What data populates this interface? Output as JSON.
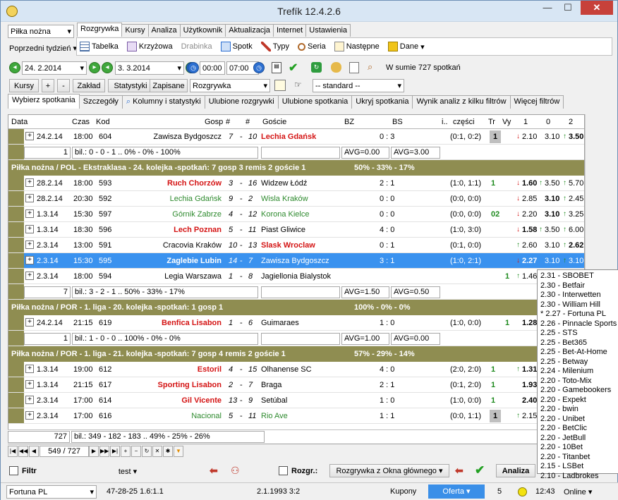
{
  "window": {
    "title": "Trefík 12.4.2.6",
    "min": "—",
    "max": "☐",
    "close": "✕"
  },
  "sport_select": "Piłka nożna",
  "period_select": "Poprzedni tydzień",
  "main_tabs": [
    "Rozgrywka",
    "Kursy",
    "Analiza",
    "Użytkownik",
    "Aktualizacja",
    "Internet",
    "Ustawienia"
  ],
  "ribbon": {
    "tabelka": "Tabelka",
    "krzyzowa": "Krzyżowa",
    "drabinka": "Drabinka",
    "spotk": "Spotk",
    "typy": "Typy",
    "seria": "Seria",
    "nastepne": "Następne",
    "dane": "Dane"
  },
  "filter_row": {
    "date_from": "24. 2.2014",
    "date_to": "3. 3.2014",
    "time_from": "00:00",
    "time_to": "07:00",
    "total": "W sumie 727 spotkań"
  },
  "buttons_row": {
    "kursy": "Kursy",
    "plus": "+",
    "minus": "-",
    "zaklad": "Zakład",
    "statystyki": "Statystyki",
    "zapisane": "Zapisane",
    "rozgrywka_select": "Rozgrywka",
    "standard_select": "-- standard --"
  },
  "sub_tabs": [
    "Wybierz spotkania",
    "Szczegóły",
    "Kolumny i statystyki",
    "Ulubione rozgrywki",
    "Ulubione spotkania",
    "Ukryj spotkania",
    "Wynik analiz z kilku filtrów",
    "Więcej filtrów"
  ],
  "columns": {
    "data": "Data",
    "czas": "Czas",
    "kod": "Kod",
    "gosp": "Gosp",
    "h": "#",
    "a": "#",
    "goscie": "Goście",
    "bz": "BZ",
    "bs": "BS",
    "i": "i..",
    "czesci": "części",
    "tr": "Tr",
    "vy": "Vy",
    "o1": "1",
    "o0": "0",
    "o2": "2"
  },
  "groups": [
    {
      "title": "",
      "matches": [
        {
          "date": "24.2.14",
          "time": "18:00",
          "code": "604",
          "home": "Zawisza Bydgoszcz",
          "hs": "red0",
          "hr": "7",
          "ar": "10",
          "away": "Lechia Gdańsk",
          "as": "red",
          "bz": "0 : 3",
          "bs": "",
          "parts": "(0:1, 0:2)",
          "tr": "1",
          "trbox": true,
          "vy": "",
          "o1": "2.10",
          "o0": "3.10",
          "o2": "3.50",
          "a1": "dn",
          "a0": "",
          "a2": "up",
          "b": "2"
        }
      ],
      "summary": {
        "count": "1",
        "bil": "bil.: 0 - 0 - 1 .. 0% - 0% - 100%",
        "avg1": "AVG=0.00",
        "avg2": "AVG=3.00"
      }
    },
    {
      "title": "Piłka nożna / POL - Ekstraklasa - 24. kolejka -spotkań: 7 gosp 3  remis 2  goście 1",
      "stats": "50% - 33% - 17%",
      "matches": [
        {
          "date": "28.2.14",
          "time": "18:00",
          "code": "593",
          "home": "Ruch Chorzów",
          "hs": "red",
          "hr": "3",
          "ar": "16",
          "away": "Widzew Łódź",
          "as": "",
          "bz": "2 : 1",
          "parts": "(1:0, 1:1)",
          "tr": "1",
          "trcls": "grnb",
          "vy": "",
          "o1": "1.60",
          "o0": "3.50",
          "o2": "5.70",
          "a1": "dn",
          "a0": "up",
          "a2": "up",
          "b": "1"
        },
        {
          "date": "28.2.14",
          "time": "20:30",
          "code": "592",
          "home": "Lechia Gdańsk",
          "hs": "grn",
          "hr": "9",
          "ar": "2",
          "away": "Wisla Kraków",
          "as": "grn",
          "bz": "0 : 0",
          "parts": "(0:0, 0:0)",
          "tr": "",
          "vy": "",
          "o1": "2.85",
          "o0": "3.10",
          "o2": "2.45",
          "a1": "dn",
          "a0": "",
          "a2": "up",
          "b": "0"
        },
        {
          "date": "1.3.14",
          "time": "15:30",
          "code": "597",
          "home": "Górnik Zabrze",
          "hs": "grn",
          "hr": "4",
          "ar": "12",
          "away": "Korona Kielce",
          "as": "grn",
          "bz": "0 : 0",
          "parts": "(0:0, 0:0)",
          "tr": "02",
          "trcls": "grnb",
          "vy": "",
          "o1": "2.20",
          "o0": "3.10",
          "o2": "3.25",
          "a1": "dn",
          "a0": "",
          "a2": "up",
          "b": "0"
        },
        {
          "date": "1.3.14",
          "time": "18:30",
          "code": "596",
          "home": "Lech Poznan",
          "hs": "red",
          "hr": "5",
          "ar": "11",
          "away": "Piast Gliwice",
          "as": "",
          "bz": "4 : 0",
          "parts": "(1:0, 3:0)",
          "tr": "",
          "vy": "",
          "o1": "1.58",
          "o0": "3.50",
          "o2": "6.00",
          "a1": "dn",
          "a0": "up",
          "a2": "up",
          "b": "1"
        },
        {
          "date": "2.3.14",
          "time": "13:00",
          "code": "591",
          "home": "Cracovia Kraków",
          "hs": "",
          "hr": "10",
          "ar": "13",
          "away": "Slask Wroclaw",
          "as": "red",
          "bz": "0 : 1",
          "parts": "(0:1, 0:0)",
          "tr": "",
          "vy": "",
          "o1": "2.60",
          "o0": "3.10",
          "o2": "2.62",
          "a1": "up",
          "a0": "",
          "a2": "up",
          "b": "2"
        },
        {
          "date": "2.3.14",
          "time": "15:30",
          "code": "595",
          "home": "Zaglebie Lubin",
          "hs": "red",
          "hr": "14",
          "ar": "7",
          "away": "Zawisza Bydgoszcz",
          "as": "",
          "bz": "3 : 1",
          "parts": "(1:0, 2:1)",
          "tr": "",
          "vy": "",
          "o1": "2.27",
          "o0": "3.10",
          "o2": "3.10",
          "a1": "dn",
          "a0": "",
          "a2": "up",
          "b": "1",
          "sel": true
        },
        {
          "date": "2.3.14",
          "time": "18:00",
          "code": "594",
          "home": "Legia Warszawa",
          "hs": "",
          "hr": "1",
          "ar": "8",
          "away": "Jagiellonia Bialystok",
          "as": "",
          "bz": "",
          "parts": "",
          "tr": "",
          "vy": "1",
          "o1": "1.46",
          "o0": "",
          "o2": "",
          "a1": "up",
          "a0": "",
          "a2": "",
          "b": ""
        }
      ],
      "summary": {
        "count": "7",
        "bil": "bil.: 3 - 2 - 1 .. 50% - 33% - 17%",
        "avg1": "AVG=1.50",
        "avg2": "AVG=0.50"
      }
    },
    {
      "title": "Piłka nożna / POR - 1. liga - 20. kolejka -spotkań: 1  gosp 1",
      "stats": "100% - 0% - 0%",
      "matches": [
        {
          "date": "24.2.14",
          "time": "21:15",
          "code": "619",
          "home": "Benfica Lisabon",
          "hs": "red",
          "hr": "1",
          "ar": "6",
          "away": "Guimaraes",
          "as": "",
          "bz": "1 : 0",
          "parts": "(1:0, 0:0)",
          "tr": "",
          "vy": "1",
          "o1": "1.28",
          "o0": "",
          "o2": "",
          "a1": "",
          "a0": "",
          "a2": "",
          "b": "1"
        }
      ],
      "summary": {
        "count": "1",
        "bil": "bil.: 1 - 0 - 0 .. 100% - 0% - 0%",
        "avg1": "AVG=1.00",
        "avg2": "AVG=0.00"
      }
    },
    {
      "title": "Piłka nożna / POR - 1. liga - 21. kolejka -spotkań: 7  gosp 4  remis 2  goście 1",
      "stats": "57% - 29% - 14%",
      "matches": [
        {
          "date": "1.3.14",
          "time": "19:00",
          "code": "612",
          "home": "Estoril",
          "hs": "red",
          "hr": "4",
          "ar": "15",
          "away": "Olhanense SC",
          "as": "",
          "bz": "4 : 0",
          "parts": "(2:0, 2:0)",
          "tr": "1",
          "trcls": "grnb",
          "vy": "",
          "o1": "1.31",
          "o0": "",
          "o2": "",
          "a1": "up",
          "a0": "",
          "a2": "",
          "b": "1"
        },
        {
          "date": "1.3.14",
          "time": "21:15",
          "code": "617",
          "home": "Sporting Lisabon",
          "hs": "red",
          "hr": "2",
          "ar": "7",
          "away": "Braga",
          "as": "",
          "bz": "2 : 1",
          "parts": "(0:1, 2:0)",
          "tr": "1",
          "trcls": "grnb",
          "vy": "",
          "o1": "1.93",
          "o0": "",
          "o2": "",
          "a1": "",
          "a0": "",
          "a2": "",
          "b": "1"
        },
        {
          "date": "2.3.14",
          "time": "17:00",
          "code": "614",
          "home": "Gil Vicente",
          "hs": "red",
          "hr": "13",
          "ar": "9",
          "away": "Setúbal",
          "as": "",
          "bz": "1 : 0",
          "parts": "(1:0, 0:0)",
          "tr": "1",
          "trcls": "grnb",
          "vy": "",
          "o1": "2.40",
          "o0": "",
          "o2": "",
          "a1": "",
          "a0": "",
          "a2": "",
          "b": "1"
        },
        {
          "date": "2.3.14",
          "time": "17:00",
          "code": "616",
          "home": "Nacional",
          "hs": "grn",
          "hr": "5",
          "ar": "11",
          "away": "Rio Ave",
          "as": "grn",
          "bz": "1 : 1",
          "parts": "(0:0, 1:1)",
          "tr": "1",
          "trbox": true,
          "vy": "",
          "o1": "2.15",
          "o0": "",
          "o2": "",
          "a1": "up",
          "a0": "",
          "a2": "",
          "b": ""
        }
      ]
    }
  ],
  "bottom_summary": {
    "count": "727",
    "bil": "bil.: 349 - 182 - 183 .. 49% - 25% - 26%"
  },
  "nav": {
    "position": "549 / 727"
  },
  "bottom_bar": {
    "filtr": "Filtr",
    "test": "test",
    "rozgr": "Rozgr.:",
    "rozgrywka_okna": "Rozgrywka z Okna głównego",
    "analiza": "Analiza"
  },
  "bookmakers": [
    "2.31 - SBOBET",
    "2.30 - Betfair",
    "2.30 - Interwetten",
    "2.30 - William Hill",
    "* 2.27 - Fortuna PL",
    "2.26 - Pinnacle Sports",
    "2.25 - STS",
    "2.25 - Bet365",
    "2.25 - Bet-At-Home",
    "2.25 - Betway",
    "2.24 - Milenium",
    "2.20 - Toto-Mix",
    "2.20 - Gamebookers",
    "2.20 - Expekt",
    "2.20 - bwin",
    "2.20 - Unibet",
    "2.20 - BetClic",
    "2.20 - JetBull",
    "2.20 - 10Bet",
    "2.20 - Titanbet",
    "2.15 - LSBet",
    "2.10 - Ladbrokes"
  ],
  "status": {
    "bookmaker": "Fortuna PL",
    "record": "47-28-25  1.6:1.1",
    "date": "2.1.1993 3:2",
    "kupony": "Kupony",
    "oferta": "Oferta",
    "num": "5",
    "time": "12:43",
    "online": "Online"
  },
  "colors": {
    "section": "#8f8d51",
    "selected": "#3a92ef",
    "red": "#d41414",
    "green": "#2e8a2e"
  }
}
